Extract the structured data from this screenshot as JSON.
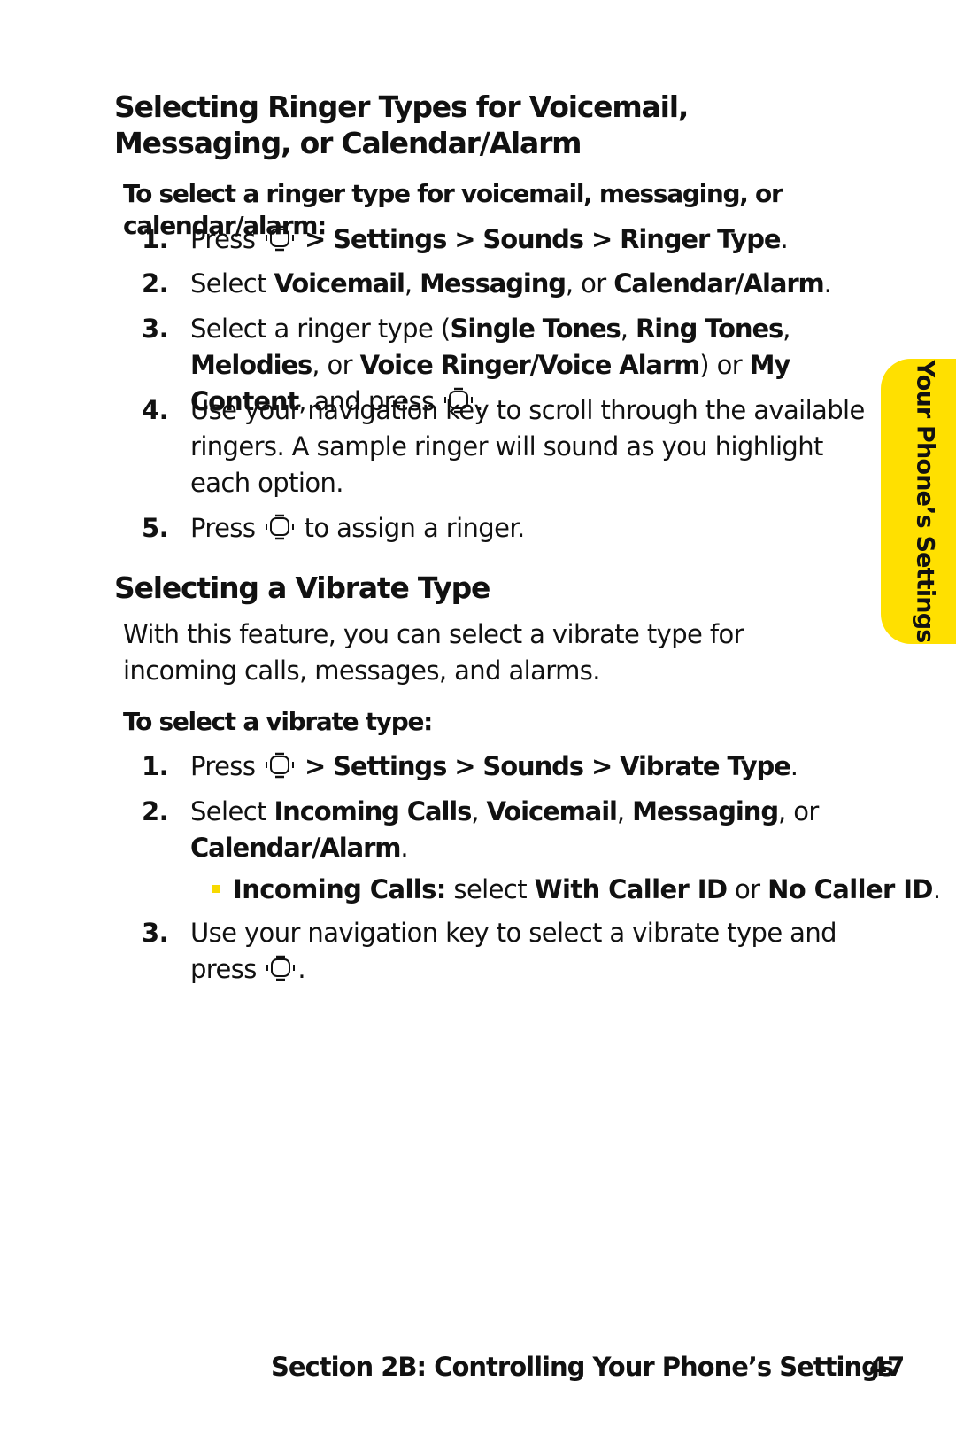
{
  "heading1": "Selecting Ringer Types for Voicemail, Messaging, or Calendar/Alarm",
  "lead1": "To select a ringer type for voicemail, messaging, or calendar/alarm:",
  "steps1": [
    {
      "num": "1.",
      "segs": [
        {
          "t": "Press "
        },
        {
          "icon": "menu-ok-key-icon"
        },
        {
          "t": " > Settings > Sounds > Ringer Type",
          "b": true
        },
        {
          "t": "."
        }
      ]
    },
    {
      "num": "2.",
      "segs": [
        {
          "t": "Select "
        },
        {
          "t": "Voicemail",
          "b": true
        },
        {
          "t": ", "
        },
        {
          "t": "Messaging",
          "b": true
        },
        {
          "t": ", or "
        },
        {
          "t": "Calendar/Alarm",
          "b": true
        },
        {
          "t": "."
        }
      ]
    },
    {
      "num": "3.",
      "segs": [
        {
          "t": "Select a ringer type ("
        },
        {
          "t": "Single Tones",
          "b": true
        },
        {
          "t": ", "
        },
        {
          "t": "Ring Tones",
          "b": true
        },
        {
          "t": ", "
        },
        {
          "t": "Melodies",
          "b": true
        },
        {
          "t": ", or "
        },
        {
          "t": "Voice Ringer/Voice Alarm",
          "b": true
        },
        {
          "t": ") or "
        },
        {
          "t": "My Content",
          "b": true
        },
        {
          "t": ", and press "
        },
        {
          "icon": "menu-ok-key-icon"
        },
        {
          "t": "."
        }
      ]
    },
    {
      "num": "4.",
      "segs": [
        {
          "t": "Use your navigation key to scroll through the available ringers. A sample ringer will sound as you highlight each option."
        }
      ]
    },
    {
      "num": "5.",
      "segs": [
        {
          "t": "Press "
        },
        {
          "icon": "menu-ok-key-icon"
        },
        {
          "t": " to assign a ringer."
        }
      ]
    }
  ],
  "heading2": "Selecting a Vibrate Type",
  "paragraph": "With this feature, you can select a vibrate type for incoming calls, messages, and alarms.",
  "lead2": "To select a vibrate type:",
  "steps2": [
    {
      "num": "1.",
      "segs": [
        {
          "t": "Press "
        },
        {
          "icon": "menu-ok-key-icon"
        },
        {
          "t": " > Settings > Sounds > Vibrate Type",
          "b": true
        },
        {
          "t": "."
        }
      ]
    },
    {
      "num": "2.",
      "segs": [
        {
          "t": "Select "
        },
        {
          "t": "Incoming Calls",
          "b": true
        },
        {
          "t": ", "
        },
        {
          "t": "Voicemail",
          "b": true
        },
        {
          "t": ", "
        },
        {
          "t": "Messaging",
          "b": true
        },
        {
          "t": ", or "
        },
        {
          "t": "Calendar/Alarm",
          "b": true
        },
        {
          "t": "."
        }
      ]
    },
    {
      "num": "3.",
      "segs": [
        {
          "t": "Use your navigation key to select a vibrate type and press "
        },
        {
          "icon": "menu-ok-key-icon"
        },
        {
          "t": "."
        }
      ]
    }
  ],
  "bullet": {
    "segs": [
      {
        "t": "Incoming Calls:",
        "b": true
      },
      {
        "t": " select "
      },
      {
        "t": "With Caller ID",
        "b": true
      },
      {
        "t": " or "
      },
      {
        "t": "No Caller ID",
        "b": true
      },
      {
        "t": "."
      }
    ]
  },
  "side_tab": "Your Phone’s Settings",
  "footer": "Section 2B: Controlling Your Phone’s Settings",
  "page_number": "47",
  "colors": {
    "tab": "#ffe000",
    "bullet": "#f7d900"
  }
}
